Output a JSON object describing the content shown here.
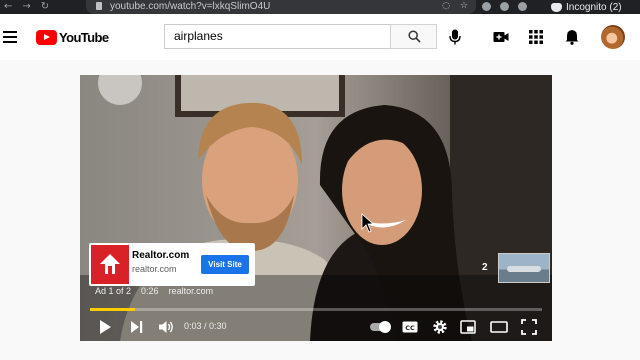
{
  "browser": {
    "url": "youtube.com/watch?v=lxkqSlimO4U",
    "incognito_label": "Incognito (2)"
  },
  "header": {
    "logo_text": "YouTube",
    "search_value": "airplanes"
  },
  "player": {
    "ad": {
      "advertiser_name": "Realtor.com",
      "advertiser_domain": "realtor.com",
      "cta_label": "Visit Site",
      "ad_position": "Ad 1 of 2",
      "ad_remaining": "0:26",
      "ad_domain": "realtor.com",
      "next_count": "2"
    },
    "time": "0:03 / 0:30",
    "progress_fraction": 0.1
  },
  "colors": {
    "brand_red": "#ff0000",
    "progress": "#ffcc00",
    "cta_blue": "#1a73e8",
    "realtor_red": "#d92228"
  },
  "icons": [
    "back-icon",
    "forward-icon",
    "reload-icon",
    "lock-icon",
    "incognito-icon",
    "menu-icon",
    "search-icon",
    "mic-icon",
    "create-icon",
    "apps-icon",
    "bell-icon",
    "play-icon",
    "next-icon",
    "volume-icon",
    "cc-icon",
    "settings-icon",
    "miniplayer-icon",
    "theater-icon",
    "fullscreen-icon"
  ]
}
